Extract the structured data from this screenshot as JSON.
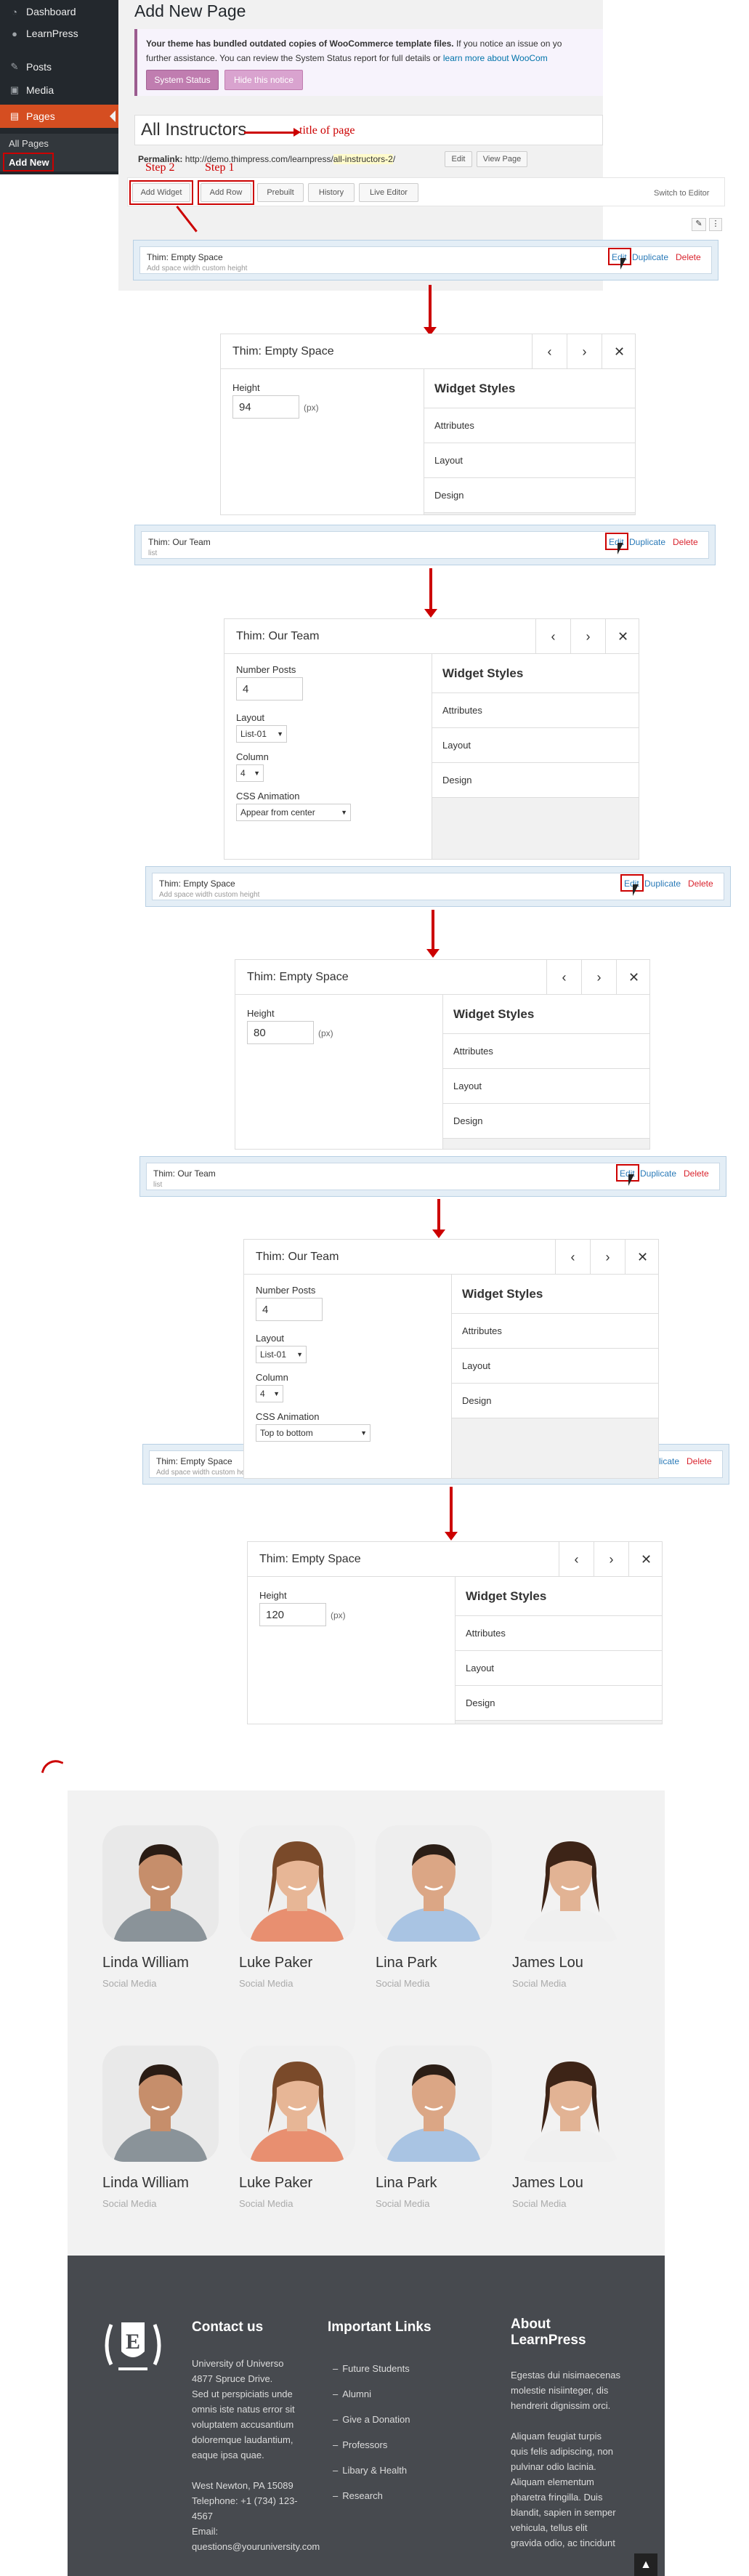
{
  "sidebar": {
    "items": [
      {
        "label": "Dashboard",
        "icon": "dashboard-icon"
      },
      {
        "label": "LearnPress",
        "icon": "learnpress-icon"
      },
      {
        "label": "Posts",
        "icon": "pin-icon"
      },
      {
        "label": "Media",
        "icon": "media-icon"
      },
      {
        "label": "Pages",
        "icon": "pages-icon"
      }
    ],
    "sub_items": [
      "All Pages",
      "Add New"
    ]
  },
  "page": {
    "heading": "Add New Page",
    "notice_text_bold": "Your theme has bundled outdated copies of WooCommerce template files.",
    "notice_text_1": " If you notice an issue on yo",
    "notice_text_2": "further assistance. You can review the System Status report for full details or ",
    "notice_link": "learn more about WooCom",
    "system_status_button": "System Status",
    "hide_notice_button": "Hide this notice",
    "title_value": "All Instructors",
    "title_annotation": "title of page",
    "permalink_label": "Permalink:",
    "permalink_base": "http://demo.thimpress.com/learnpress/",
    "permalink_slug": "all-instructors-2",
    "permalink_end": "/",
    "edit_button": "Edit",
    "view_button": "View Page"
  },
  "toolbar": {
    "add_widget": "Add Widget",
    "add_row": "Add Row",
    "prebuilt": "Prebuilt",
    "history": "History",
    "live_editor": "Live Editor",
    "switch_editor": "Switch to Editor",
    "step1": "Step 1",
    "step2": "Step 2"
  },
  "widget_rows": [
    {
      "title": "Thim: Empty Space",
      "subtitle": "Add space width custom height"
    },
    {
      "title": "Thim: Our Team",
      "subtitle": "list"
    },
    {
      "title": "Thim: Empty Space",
      "subtitle": "Add space width custom height"
    },
    {
      "title": "Thim: Our Team",
      "subtitle": "list"
    },
    {
      "title": "Thim: Empty Space",
      "subtitle": "Add space width custom height"
    }
  ],
  "row_actions": {
    "edit": "Edit",
    "duplicate": "Duplicate",
    "delete": "Delete"
  },
  "dialogs": [
    {
      "title": "Thim: Empty Space",
      "height_label": "Height",
      "height_value": "94",
      "unit": "(px)"
    },
    {
      "title": "Thim: Our Team",
      "number_posts_label": "Number Posts",
      "number_posts_value": "4",
      "layout_label": "Layout",
      "layout_value": "List-01",
      "column_label": "Column",
      "column_value": "4",
      "animation_label": "CSS Animation",
      "animation_value": "Appear from center"
    },
    {
      "title": "Thim: Empty Space",
      "height_label": "Height",
      "height_value": "80",
      "unit": "(px)"
    },
    {
      "title": "Thim: Our Team",
      "number_posts_label": "Number Posts",
      "number_posts_value": "4",
      "layout_label": "Layout",
      "layout_value": "List-01",
      "column_label": "Column",
      "column_value": "4",
      "animation_label": "CSS Animation",
      "animation_value": "Top to bottom"
    },
    {
      "title": "Thim: Empty Space",
      "height_label": "Height",
      "height_value": "120",
      "unit": "(px)"
    }
  ],
  "widget_styles": {
    "title": "Widget Styles",
    "items": [
      "Attributes",
      "Layout",
      "Design"
    ]
  },
  "team": {
    "members": [
      {
        "name": "Linda William",
        "role": "Social Media"
      },
      {
        "name": "Luke Paker",
        "role": "Social Media"
      },
      {
        "name": "Lina Park",
        "role": "Social Media"
      },
      {
        "name": "James Lou",
        "role": "Social Media"
      },
      {
        "name": "Linda William",
        "role": "Social Media"
      },
      {
        "name": "Luke Paker",
        "role": "Social Media"
      },
      {
        "name": "Lina Park",
        "role": "Social Media"
      },
      {
        "name": "James Lou",
        "role": "Social Media"
      }
    ]
  },
  "footer": {
    "contact_title": "Contact us",
    "contact_lines": [
      "University of Universo",
      "4877 Spruce Drive.",
      "Sed ut perspiciatis unde",
      "omnis iste natus error sit",
      "voluptatem accusantium",
      "doloremque laudantium,",
      "eaque ipsa quae."
    ],
    "address_lines": [
      "West Newton, PA 15089",
      "Telephone: +1 (734) 123-",
      "4567",
      "Email:",
      "questions@youruniversity.com"
    ],
    "links_title": "Important Links",
    "links": [
      "Future Students",
      "Alumni",
      "Give a Donation",
      "Professors",
      "Libary & Health",
      "Research"
    ],
    "about_title_1": "About",
    "about_title_2": "LearnPress",
    "about_p1": [
      "Egestas dui nisimaecenas",
      "molestie nisiinteger, dis",
      "hendrerit dignissim orci."
    ],
    "about_p2": [
      "Aliquam feugiat turpis",
      "quis felis adipiscing, non",
      "pulvinar odio lacinia.",
      "Aliquam elementum",
      "pharetra fringilla. Duis",
      "blandit, sapien in semper",
      "vehicula, tellus elit",
      "gravida odio, ac tincidunt"
    ],
    "logo_letter": "E"
  },
  "colors": {
    "admin_dark": "#23282d",
    "admin_active": "#d54e21",
    "annotation": "#cc0000",
    "footer_bg": "#474a4f",
    "team_bg": "#f2f2f2"
  }
}
